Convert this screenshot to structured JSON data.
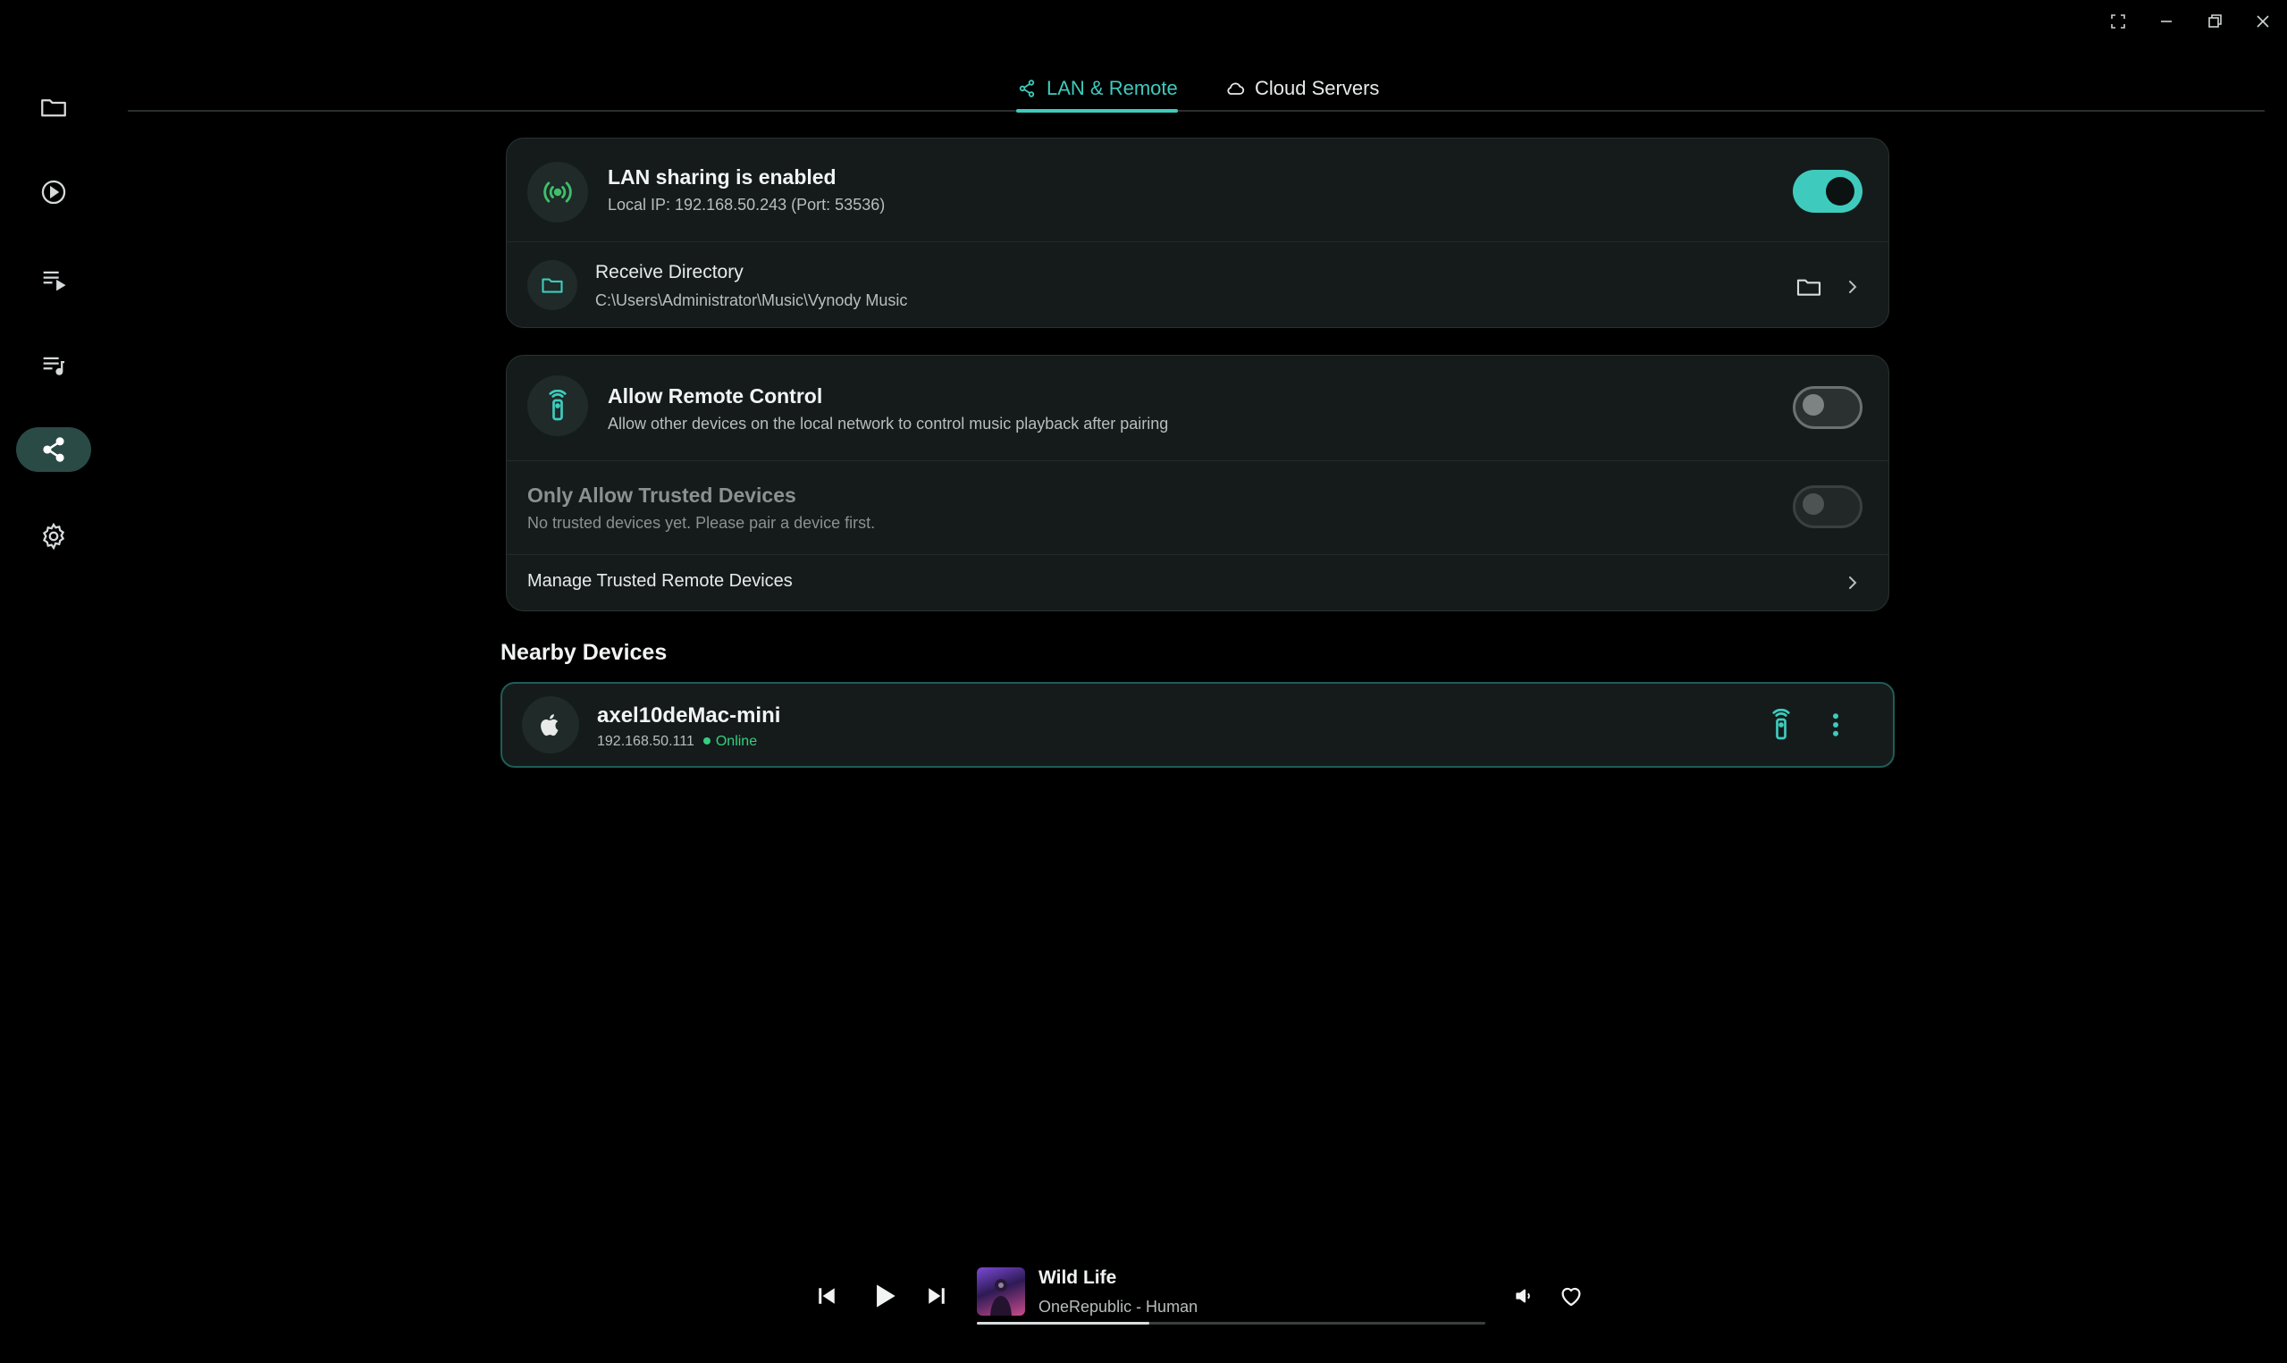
{
  "tabs": [
    {
      "label": "LAN & Remote",
      "icon": "share-icon",
      "active": true
    },
    {
      "label": "Cloud Servers",
      "icon": "cloud-icon",
      "active": false
    }
  ],
  "sidebar": {
    "items": [
      {
        "name": "folder",
        "icon": "folder-icon"
      },
      {
        "name": "now-playing",
        "icon": "play-circle-icon"
      },
      {
        "name": "queue",
        "icon": "queue-icon"
      },
      {
        "name": "playlists",
        "icon": "playlist-music-icon"
      },
      {
        "name": "share",
        "icon": "share-icon",
        "active": true
      },
      {
        "name": "settings",
        "icon": "gear-icon"
      }
    ]
  },
  "lan": {
    "title": "LAN sharing is enabled",
    "subtitle": "Local IP: 192.168.50.243 (Port: 53536)",
    "enabled": true,
    "receive_title": "Receive Directory",
    "receive_path": "C:\\Users\\Administrator\\Music\\Vynody Music"
  },
  "remote": {
    "title": "Allow Remote Control",
    "subtitle": "Allow other devices on the local network to control music playback after pairing",
    "enabled": false,
    "trusted_title": "Only Allow Trusted Devices",
    "trusted_subtitle": "No trusted devices yet. Please pair a device first.",
    "trusted_enabled": false,
    "manage_label": "Manage Trusted Remote Devices"
  },
  "nearby": {
    "title": "Nearby Devices",
    "devices": [
      {
        "name": "axel10deMac-mini",
        "ip": "192.168.50.111",
        "status": "Online"
      }
    ]
  },
  "player": {
    "title": "Wild Life",
    "subtitle": "OneRepublic - Human",
    "progress": 0.34
  },
  "colors": {
    "accent": "#3ecbbd",
    "online": "#35d07f",
    "card_bg": "#151b1b",
    "background": "#000000"
  }
}
